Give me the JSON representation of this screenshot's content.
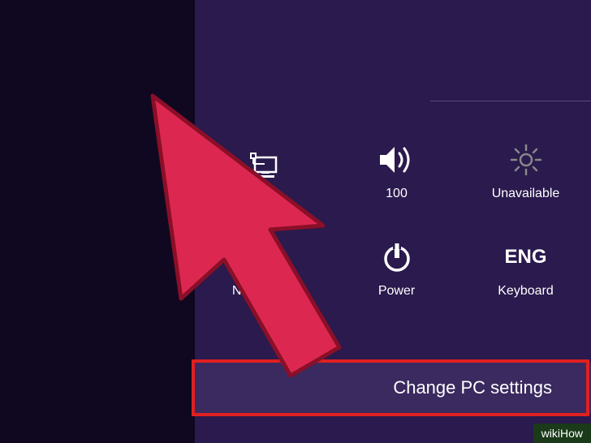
{
  "settings": {
    "tiles": [
      {
        "id": "network",
        "label": "",
        "icon": "network"
      },
      {
        "id": "volume",
        "label": "100",
        "icon": "volume"
      },
      {
        "id": "brightness",
        "label": "Unavailable",
        "icon": "brightness"
      },
      {
        "id": "notifications",
        "label": "Notifications",
        "icon": "notifications"
      },
      {
        "id": "power",
        "label": "Power",
        "icon": "power"
      },
      {
        "id": "keyboard",
        "label": "Keyboard",
        "icon": "keyboard",
        "textIcon": "ENG"
      }
    ],
    "changeSettings": "Change PC settings"
  },
  "watermark": "wikiHow"
}
